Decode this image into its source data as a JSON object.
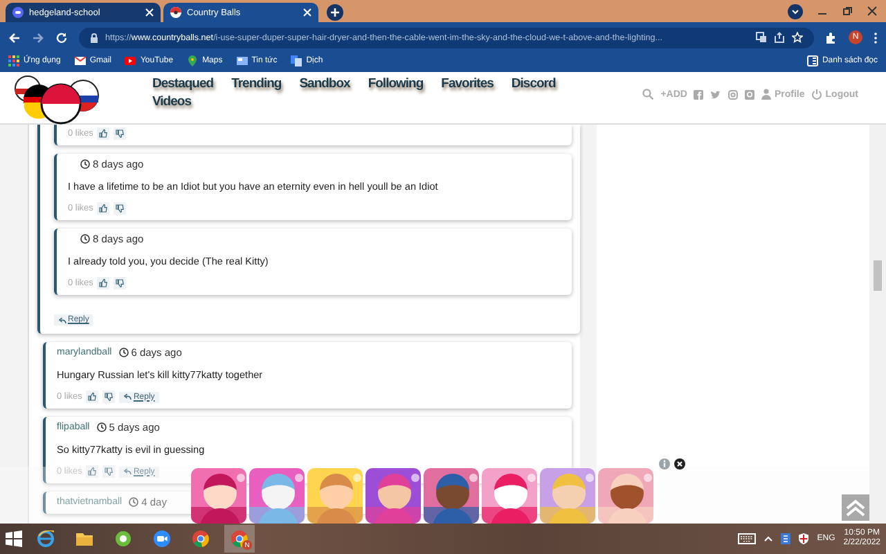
{
  "browser": {
    "tabs": [
      {
        "title": "hedgeland-school",
        "selected": false
      },
      {
        "title": "Country Balls",
        "selected": true
      }
    ],
    "url": "https://**www.countryballs.net**/i-use-super-duper-super-hair-dryer-and-then-the-cable-went-im-the-sky-and-the-cloud-we-t-above-and-the-lighting...",
    "profile_initial": "N",
    "bookmarks": [
      "Ứng dụng",
      "Gmail",
      "YouTube",
      "Maps",
      "Tin tức",
      "Dịch"
    ],
    "reading_list": "Danh sách đọc"
  },
  "site": {
    "nav": [
      "Destaqued",
      "Trending",
      "Sandbox",
      "Following",
      "Favorites",
      "Discord",
      "Videos"
    ],
    "add": "+ADD",
    "profile": "Profile",
    "logout": "Logout"
  },
  "thread": {
    "replies": [
      {
        "likes": "0 likes"
      },
      {
        "time": "8 days ago",
        "text": "I have a lifetime to be an Idiot but you have an eternity even in hell youll be an Idiot",
        "likes": "0 likes"
      },
      {
        "time": "8 days ago",
        "text": "I already told you, you decide (The real Kitty)",
        "likes": "0 likes"
      }
    ],
    "reply": "Reply"
  },
  "comments": [
    {
      "author": "marylandball",
      "time": "6 days ago",
      "text": "Hungary Russian let's kill kitty77katty together",
      "likes": "0 likes",
      "reply": "Reply"
    },
    {
      "author": "flipaball",
      "time": "5 days ago",
      "text": "So kitty77katty is evil in guessing",
      "likes": "0 likes",
      "reply": "Reply"
    },
    {
      "author": "thatvietnamball",
      "time": "4 day"
    }
  ],
  "taskbar": {
    "apps": [
      {
        "selected": false
      },
      {
        "selected": false
      },
      {
        "selected": false
      },
      {
        "selected": false
      },
      {
        "selected": false
      },
      {
        "selected": true
      }
    ],
    "profile_badge": "N",
    "language": "ENG",
    "time": "10:50 PM",
    "date": "2/22/2022"
  }
}
